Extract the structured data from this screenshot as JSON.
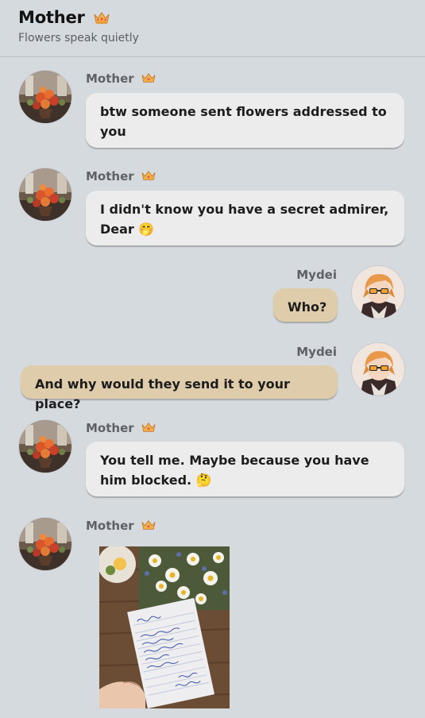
{
  "header": {
    "title": "Mother",
    "subtitle": "Flowers speak quietly",
    "crown_icon": "crown-icon"
  },
  "messages": [
    {
      "sender": "Mother",
      "text": "btw someone sent flowers addressed to you"
    },
    {
      "sender": "Mother",
      "text": "I didn't know you have a secret admirer, Dear 🤭"
    },
    {
      "sender": "Mydei",
      "text": "Who?"
    },
    {
      "sender": "Mydei",
      "text": "And why would they send it to your place?"
    },
    {
      "sender": "Mother",
      "text": "You tell me. Maybe because you have him blocked. 🤔"
    },
    {
      "sender": "Mother",
      "image": "photo of a handwritten note with daisies on a wooden table"
    }
  ],
  "colors": {
    "background": "#d5dade",
    "incoming_bubble": "#ececec",
    "outgoing_bubble": "#dfccaa"
  }
}
